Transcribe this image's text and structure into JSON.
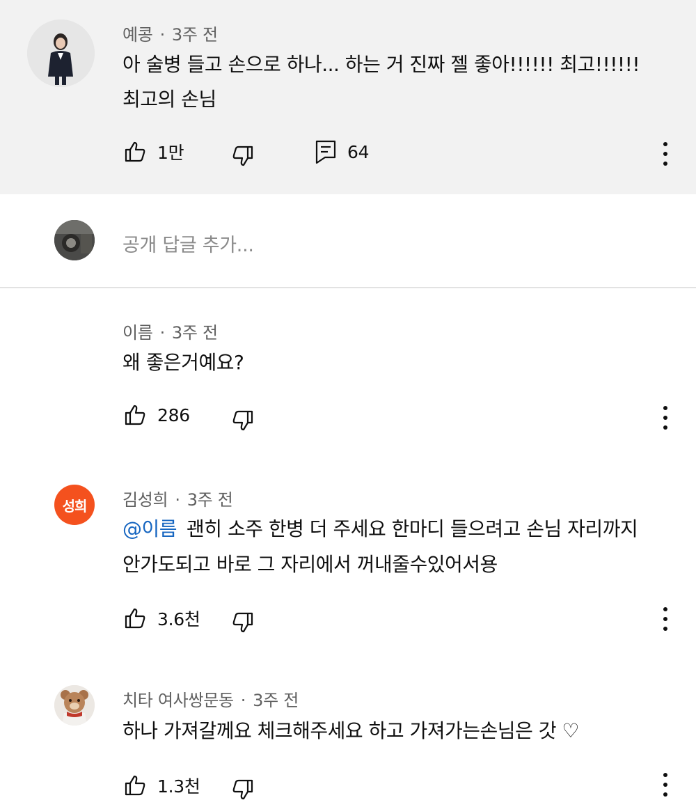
{
  "top_comment": {
    "author": "예콩",
    "time": "3주 전",
    "lines": [
      "아 술병 들고 손으로 하나... 하는 거 진짜 젤 좋아!!!!!! 최고!!!!!!",
      "최고의 손님"
    ],
    "likes": "1만",
    "replies": "64",
    "icons": [
      "thumbs-up-icon",
      "thumbs-down-icon",
      "comment-icon",
      "more-vert-icon"
    ]
  },
  "reply_box": {
    "placeholder": "공개 답글 추가..."
  },
  "replies": [
    {
      "author": "이름",
      "time": "3주 전",
      "lines": [
        "왜 좋은거예요?"
      ],
      "likes": "286"
    },
    {
      "author": "김성희",
      "time": "3주 전",
      "avatar_initials": "성희",
      "avatar_color": "#f4511e",
      "mention": "@이름",
      "lines": [
        "괜히 소주 한병 더 주세요 한마디 들으려고 손님 자리까지",
        "안가도되고 바로 그 자리에서 꺼내줄수있어서용"
      ],
      "likes": "3.6천"
    },
    {
      "author": "치타 여사쌍문동",
      "time": "3주 전",
      "lines": [
        "하나 가져갈께요 체크해주세요 하고 가져가는손님은  갓 ♡"
      ],
      "likes": "1.3천"
    }
  ],
  "colors": {
    "highlight_bg": "#f2f2f2",
    "mention": "#1565c0",
    "meta_text": "#606060"
  }
}
